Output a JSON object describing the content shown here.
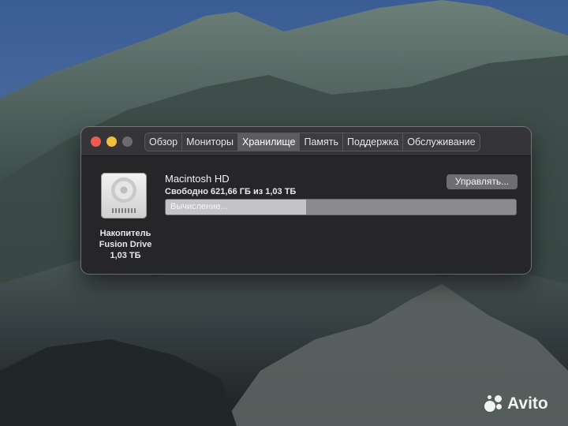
{
  "window": {
    "tabs": [
      {
        "label": "Обзор"
      },
      {
        "label": "Мониторы"
      },
      {
        "label": "Хранилище",
        "active": true
      },
      {
        "label": "Память"
      },
      {
        "label": "Поддержка"
      },
      {
        "label": "Обслуживание"
      }
    ]
  },
  "storage": {
    "disk_icon": "hard-drive-icon",
    "disk_caption": [
      "Накопитель",
      "Fusion Drive",
      "1,03 ТБ"
    ],
    "volume_name": "Macintosh HD",
    "free_space": "Свободно 621,66 ГБ из 1,03 ТБ",
    "manage_button": "Управлять...",
    "progress_label": "Вычисление...",
    "progress_fraction": 0.4
  },
  "watermark": {
    "icon": "avito-logo-icon",
    "text": "Avito"
  },
  "colors": {
    "window_bg": "#262628",
    "titlebar_bg": "#353538",
    "close": "#ee5a52",
    "minimize": "#f2bd3d",
    "zoom": "#6b6b6e",
    "active_tab": "#5c5c61"
  }
}
